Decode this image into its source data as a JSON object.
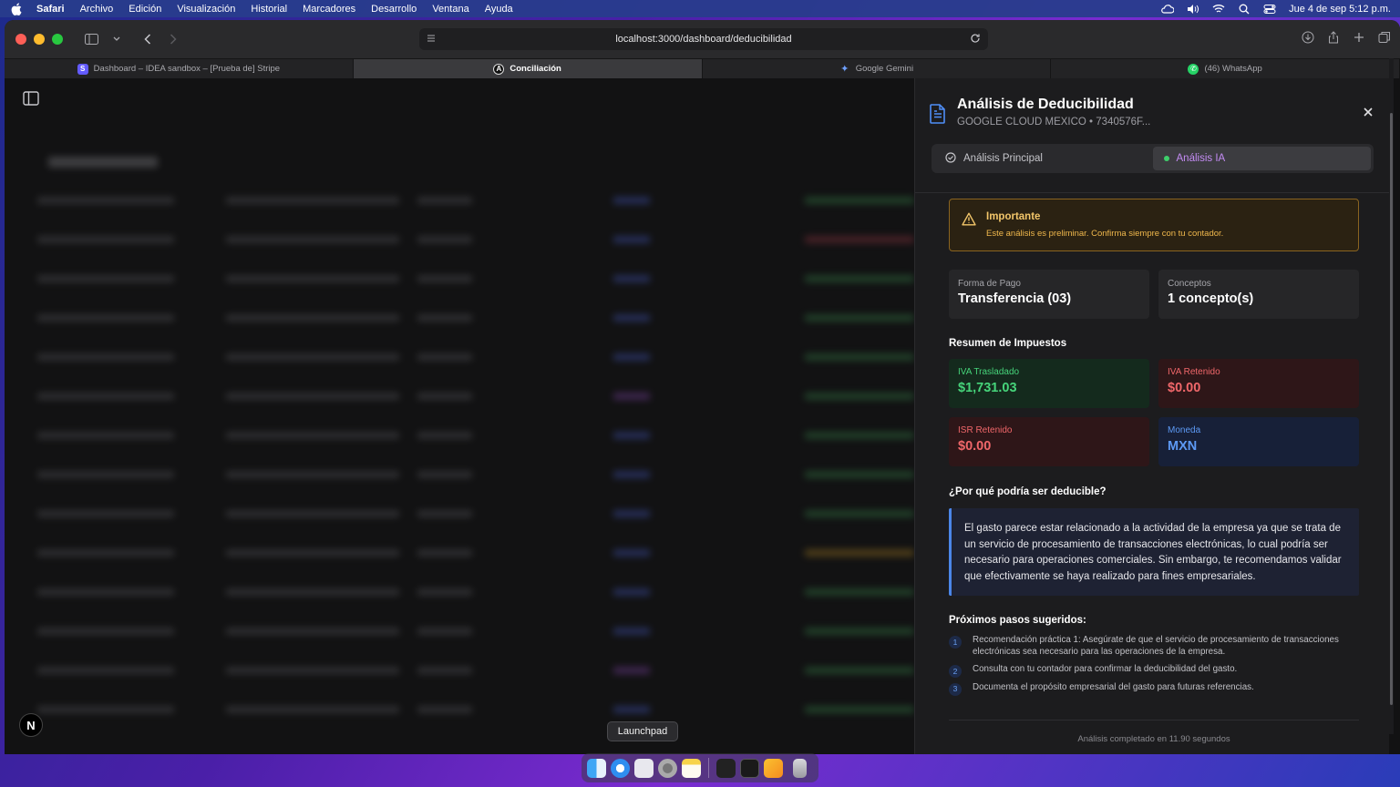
{
  "menubar": {
    "app": "Safari",
    "items": [
      "Archivo",
      "Edición",
      "Visualización",
      "Historial",
      "Marcadores",
      "Desarrollo",
      "Ventana",
      "Ayuda"
    ],
    "datetime": "Jue 4 de sep  5:12 p.m."
  },
  "browser": {
    "url": "localhost:3000/dashboard/deducibilidad",
    "tabs": [
      {
        "label": "Dashboard – IDEA sandbox – [Prueba de] Stripe",
        "favicon": "S",
        "color": "#635bff"
      },
      {
        "label": "Conciliación",
        "favicon": "A",
        "color": "#111111"
      },
      {
        "label": "Google Gemini",
        "favicon": "✦",
        "color": "#4c8bf5"
      },
      {
        "label": "(46) WhatsApp",
        "favicon": "✆",
        "color": "#25d366"
      }
    ]
  },
  "panel": {
    "title": "Análisis de Deducibilidad",
    "subtitle": "GOOGLE CLOUD MEXICO • 7340576F...",
    "tabs": {
      "principal": "Análisis Principal",
      "ia": "Análisis IA"
    },
    "warning": {
      "title": "Importante",
      "text": "Este análisis es preliminar. Confirma siempre con tu contador."
    },
    "payment": {
      "label": "Forma de Pago",
      "value": "Transferencia (03)"
    },
    "concepts": {
      "label": "Conceptos",
      "value": "1 concepto(s)"
    },
    "taxes_title": "Resumen de Impuestos",
    "taxes": {
      "iva_trasladado": {
        "label": "IVA Trasladado",
        "value": "$1,731.03"
      },
      "iva_retenido": {
        "label": "IVA Retenido",
        "value": "$0.00"
      },
      "isr_retenido": {
        "label": "ISR Retenido",
        "value": "$0.00"
      },
      "moneda": {
        "label": "Moneda",
        "value": "MXN"
      }
    },
    "why_title": "¿Por qué podría ser deducible?",
    "why_text": "El gasto parece estar relacionado a la actividad de la empresa ya que se trata de un servicio de procesamiento de transacciones electrónicas, lo cual podría ser necesario para operaciones comerciales. Sin embargo, te recomendamos validar que efectivamente se haya realizado para fines empresariales.",
    "steps_title": "Próximos pasos sugeridos:",
    "steps": [
      {
        "num": "1",
        "text": "Recomendación práctica 1: Asegúrate de que el servicio de procesamiento de transacciones electrónicas sea necesario para las operaciones de la empresa."
      },
      {
        "num": "2",
        "text": "Consulta con tu contador para confirmar la deducibilidad del gasto."
      },
      {
        "num": "3",
        "text": "Documenta el propósito empresarial del gasto para futuras referencias."
      }
    ],
    "footer": "Análisis completado en 11.90 segundos"
  },
  "dock": {
    "tooltip": "Launchpad"
  },
  "page": {
    "badge": "N"
  }
}
